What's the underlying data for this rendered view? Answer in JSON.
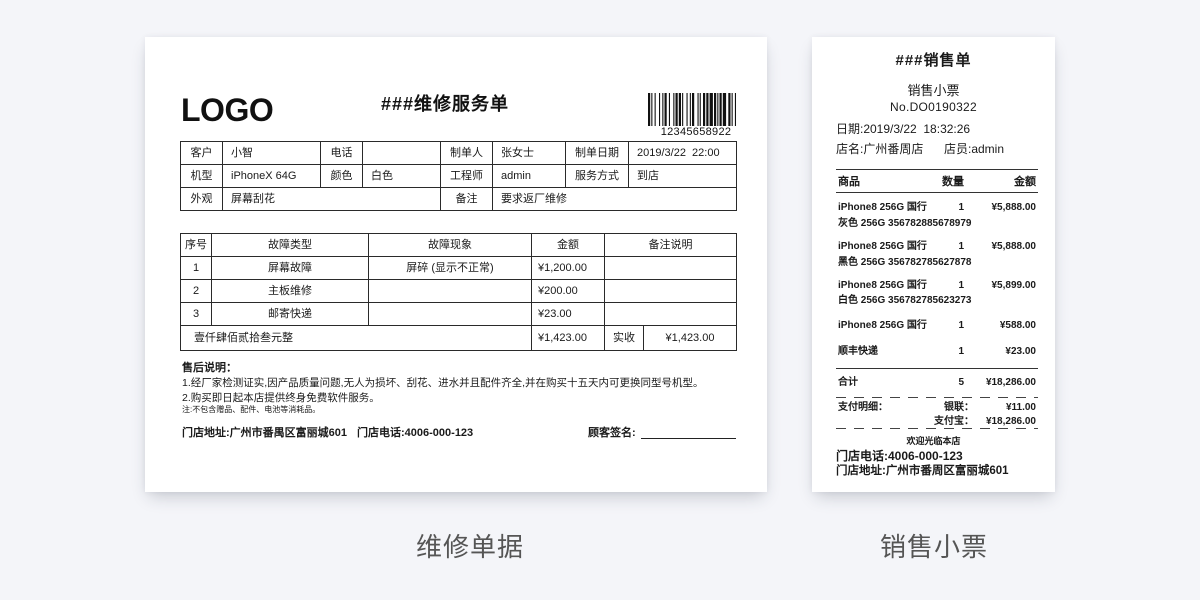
{
  "theme": {
    "background": "#f4f5f9",
    "caption_color": "#555555",
    "ink": "#1a1a1a"
  },
  "repair_form": {
    "caption": "维修单据",
    "logo": "LOGO",
    "title": "###维修服务单",
    "barcode_number": "12345658922",
    "info": {
      "customer_label": "客户",
      "customer": "小智",
      "phone_label": "电话",
      "creator_label": "制单人",
      "creator": "张女士",
      "date_label": "制单日期",
      "date": "2019/3/22  22:00",
      "model_label": "机型",
      "model": "iPhoneX 64G",
      "color_label": "颜色",
      "color": "白色",
      "engineer_label": "工程师",
      "engineer": "admin",
      "service_label": "服务方式",
      "service": "到店",
      "appearance_label": "外观",
      "appearance": "屏幕刮花",
      "remark_label": "备注",
      "remark": "要求返厂维修"
    },
    "faults": {
      "headers": [
        "序号",
        "故障类型",
        "故障现象",
        "金额",
        "备注说明"
      ],
      "rows": [
        {
          "no": "1",
          "type": "屏幕故障",
          "symptom": "屏碎 (显示不正常)",
          "amount": "¥1,200.00"
        },
        {
          "no": "2",
          "type": "主板维修",
          "amount": "¥200.00"
        },
        {
          "no": "3",
          "type": "邮寄快递",
          "amount": "¥23.00"
        }
      ],
      "total": {
        "amount_in_words": "壹仟肆佰贰拾叁元整",
        "amount": "¥1,423.00",
        "received_label": "实收",
        "received": "¥1,423.00"
      }
    },
    "after_sales": {
      "heading": "售后说明：",
      "items": [
        "1.经厂家检测证实,因产品质量问题,无人为损坏、刮花、进水并且配件齐全,并在购买十五天内可更换同型号机型。",
        "2.购买即日起本店提供终身免费软件服务。"
      ],
      "note": "注:不包含赠品、配件、电池等消耗品。"
    },
    "footer": {
      "address": "门店地址:广州市番禺区富丽城601",
      "phone": "门店电话:4006-000-123",
      "signature_label": "顾客签名:"
    }
  },
  "receipt": {
    "caption": "销售小票",
    "title": "###销售单",
    "subtitle": "销售小票",
    "number": "No.DO0190322",
    "date": "日期:2019/3/22  18:32:26",
    "store": "店名:广州番周店",
    "clerk": "店员:admin",
    "headers": {
      "item": "商品",
      "qty": "数量",
      "amount": "金额"
    },
    "items": [
      {
        "name": "iPhone8 256G 国行",
        "qty": "1",
        "amount": "¥5,888.00",
        "detail": "灰色 256G 356782885678979"
      },
      {
        "name": "iPhone8 256G 国行",
        "qty": "1",
        "amount": "¥5,888.00",
        "detail": "黑色 256G 356782785627878"
      },
      {
        "name": "iPhone8 256G 国行",
        "qty": "1",
        "amount": "¥5,899.00",
        "detail": "白色 256G 356782785623273"
      },
      {
        "name": "iPhone8 256G 国行",
        "qty": "1",
        "amount": "¥588.00"
      },
      {
        "name": "顺丰快递",
        "qty": "1",
        "amount": "¥23.00"
      }
    ],
    "total": {
      "label": "合计",
      "qty": "5",
      "amount": "¥18,286.00"
    },
    "payment": {
      "label": "支付明细：",
      "unionpay_label": "银联：",
      "unionpay": "¥11.00",
      "alipay_label": "支付宝：",
      "alipay": "¥18,286.00"
    },
    "welcome": "欢迎光临本店",
    "phone": "门店电话:4006-000-123",
    "address": "门店地址:广州市番周区富丽城601"
  }
}
